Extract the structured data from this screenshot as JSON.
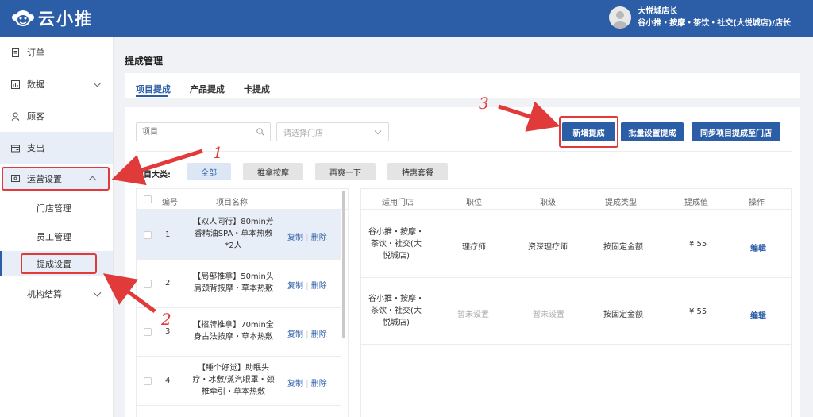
{
  "header": {
    "logo_text": "云小推",
    "user_name": "大悦城店长",
    "user_role": "谷小推・按摩・茶饮・社交(大悦城店)/店长"
  },
  "sidebar": {
    "items": [
      {
        "label": "订单",
        "icon": "document-icon"
      },
      {
        "label": "数据",
        "icon": "chart-icon"
      },
      {
        "label": "顾客",
        "icon": "user-icon"
      },
      {
        "label": "支出",
        "icon": "wallet-icon"
      },
      {
        "label": "运营设置",
        "icon": "settings-icon"
      },
      {
        "label": "机构结算"
      }
    ],
    "sub_items": [
      {
        "label": "门店管理"
      },
      {
        "label": "员工管理"
      },
      {
        "label": "提成设置"
      }
    ]
  },
  "main": {
    "page_title": "提成管理",
    "tabs": [
      {
        "label": "项目提成"
      },
      {
        "label": "产品提成"
      },
      {
        "label": "卡提成"
      }
    ],
    "search_placeholder": "项目",
    "store_placeholder": "请选择门店",
    "buttons": {
      "add": "新增提成",
      "batch": "批量设置提成",
      "sync": "同步项目提成至门店"
    },
    "category_label": "项目大类:",
    "categories": [
      "全部",
      "推拿按摩",
      "再爽一下",
      "特惠套餐"
    ],
    "left_table": {
      "headers": {
        "num": "编号",
        "name": "项目名称"
      },
      "copy_label": "复制",
      "delete_label": "删除",
      "rows": [
        {
          "num": "1",
          "name": "【双人同行】80min芳香精油SPA・草本热敷*2人"
        },
        {
          "num": "2",
          "name": "【局部推拿】50min头肩颈背按摩・草本热敷"
        },
        {
          "num": "3",
          "name": "【招牌推拿】70min全身古法按摩・草本热敷"
        },
        {
          "num": "4",
          "name": "【睡个好觉】助眠头疗・冰敷/蒸汽眼罩・颈椎牵引・草本热敷"
        }
      ]
    },
    "right_table": {
      "headers": {
        "store": "适用门店",
        "position": "职位",
        "level": "职级",
        "type": "提成类型",
        "value": "提成值",
        "action": "操作"
      },
      "edit_label": "编辑",
      "rows": [
        {
          "store": "谷小推・按摩・茶饮・社交(大悦城店)",
          "position": "理疗师",
          "level": "资深理疗师",
          "type": "按固定金额",
          "value": "¥ 55"
        },
        {
          "store": "谷小推・按摩・茶饮・社交(大悦城店)",
          "position": "暂未设置",
          "level": "暂未设置",
          "type": "按固定金额",
          "value": "¥ 55"
        }
      ]
    }
  },
  "annotations": [
    "1",
    "2",
    "3"
  ],
  "colors": {
    "primary": "#2c5ea8",
    "annotation": "#e03a3a"
  }
}
